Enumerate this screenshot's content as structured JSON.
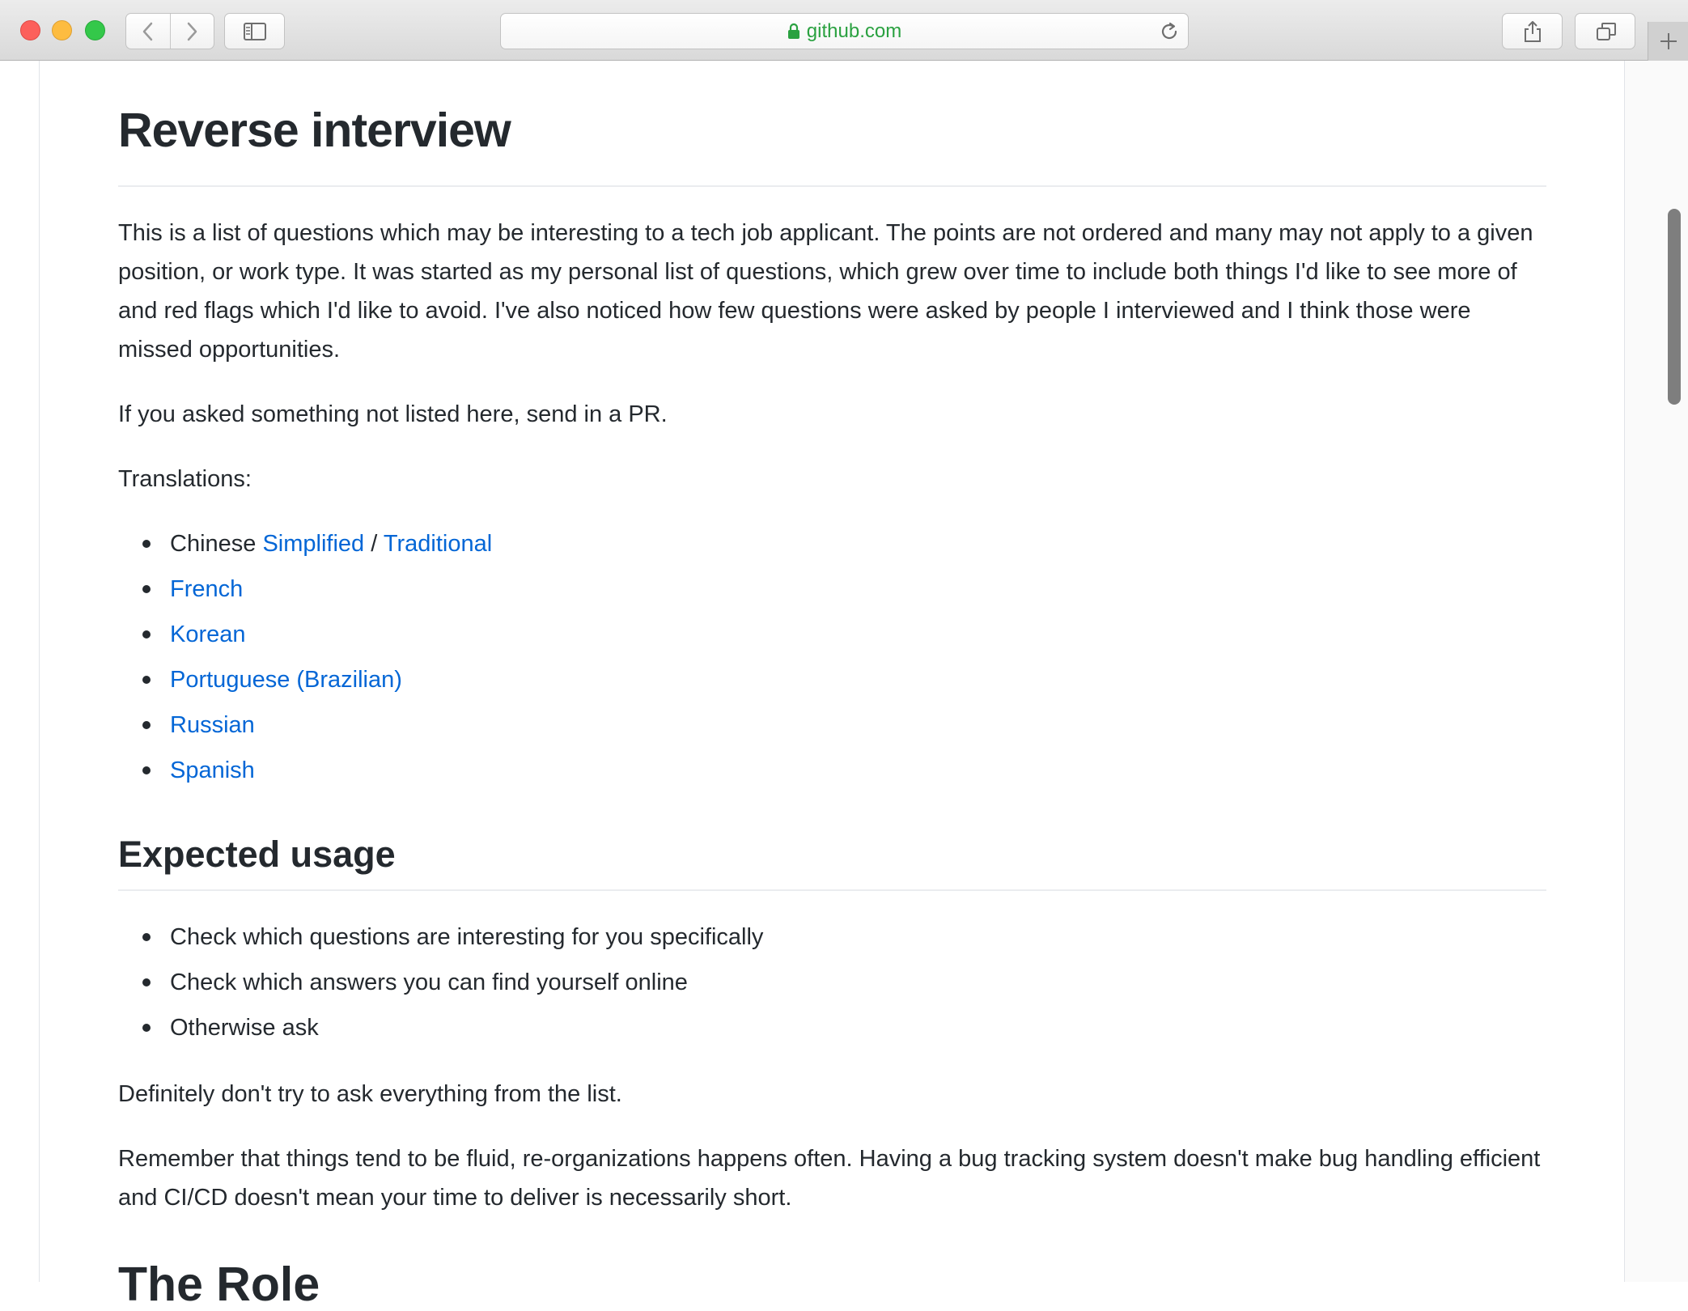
{
  "browser": {
    "url": "github.com",
    "icons": {
      "back": "chevron-left-icon",
      "forward": "chevron-right-icon",
      "sidebar": "sidebar-icon",
      "lock": "lock-icon",
      "reload": "reload-icon",
      "share": "share-icon",
      "tabs": "tabs-icon",
      "new_tab": "plus-icon"
    },
    "colors": {
      "url_text": "#2aa140",
      "link": "#0366d6",
      "text": "#24292e"
    }
  },
  "article": {
    "title": "Reverse interview",
    "intro": "This is a list of questions which may be interesting to a tech job applicant. The points are not ordered and many may not apply to a given position, or work type. It was started as my personal list of questions, which grew over time to include both things I'd like to see more of and red flags which I'd like to avoid. I've also noticed how few questions were asked by people I interviewed and I think those were missed opportunities.",
    "pr_note": "If you asked something not listed here, send in a PR.",
    "translations_label": "Translations:",
    "translations": {
      "chinese_prefix": "Chinese",
      "chinese_simplified": "Simplified",
      "separator": "/",
      "chinese_traditional": "Traditional",
      "french": "French",
      "korean": "Korean",
      "portuguese": "Portuguese (Brazilian)",
      "russian": "Russian",
      "spanish": "Spanish"
    },
    "expected_usage": {
      "heading": "Expected usage",
      "items": [
        "Check which questions are interesting for you specifically",
        "Check which answers you can find yourself online",
        "Otherwise ask"
      ],
      "note1": "Definitely don't try to ask everything from the list.",
      "note2": "Remember that things tend to be fluid, re-organizations happens often. Having a bug tracking system doesn't make bug handling efficient and CI/CD doesn't mean your time to deliver is necessarily short."
    },
    "next_heading": "The Role"
  }
}
